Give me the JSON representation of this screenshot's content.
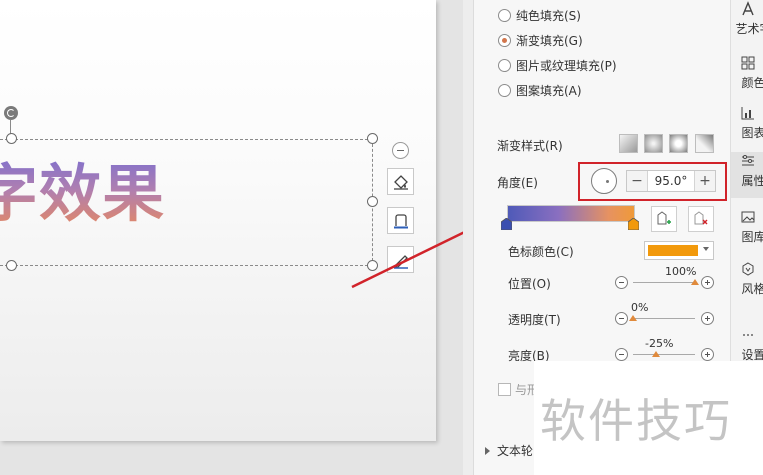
{
  "slide": {
    "art_text": "字效果"
  },
  "fill_options": [
    {
      "label": "纯色填充(S)",
      "selected": false
    },
    {
      "label": "渐变填充(G)",
      "selected": true
    },
    {
      "label": "图片或纹理填充(P)",
      "selected": false
    },
    {
      "label": "图案填充(A)",
      "selected": false
    }
  ],
  "gradient": {
    "style_label": "渐变样式(R)",
    "angle_label": "角度(E)",
    "angle_value": "95.0°",
    "angle_minus": "−",
    "angle_plus": "+",
    "stop_color_label": "色标颜色(C)",
    "stop_color_value": "#f2990b",
    "bar_colors": [
      "#4f5ab8",
      "#ef9a3a"
    ]
  },
  "sliders": {
    "position": {
      "label": "位置(O)",
      "value": "100%",
      "fraction": 1.0
    },
    "transparency": {
      "label": "透明度(T)",
      "value": "0%",
      "fraction": 0.0
    },
    "brightness": {
      "label": "亮度(B)",
      "value": "-25%",
      "fraction": 0.375
    }
  },
  "checkbox_label": "与形",
  "outline_section": "文本轮",
  "vtoolbar": [
    {
      "label": "艺术字",
      "icon": "art-text-icon",
      "active": false
    },
    {
      "label": "颜色",
      "icon": "color-grid-icon",
      "active": false
    },
    {
      "label": "图表",
      "icon": "chart-icon",
      "active": false
    },
    {
      "label": "属性",
      "icon": "properties-icon",
      "active": true
    },
    {
      "label": "图库",
      "icon": "gallery-icon",
      "active": false
    },
    {
      "label": "风格",
      "icon": "style-icon",
      "active": false
    },
    {
      "label": "设置",
      "icon": "more-icon",
      "active": false
    }
  ],
  "watermark": "软件技巧",
  "colors": {
    "highlight": "#d1232a",
    "accent": "#d2764c"
  }
}
